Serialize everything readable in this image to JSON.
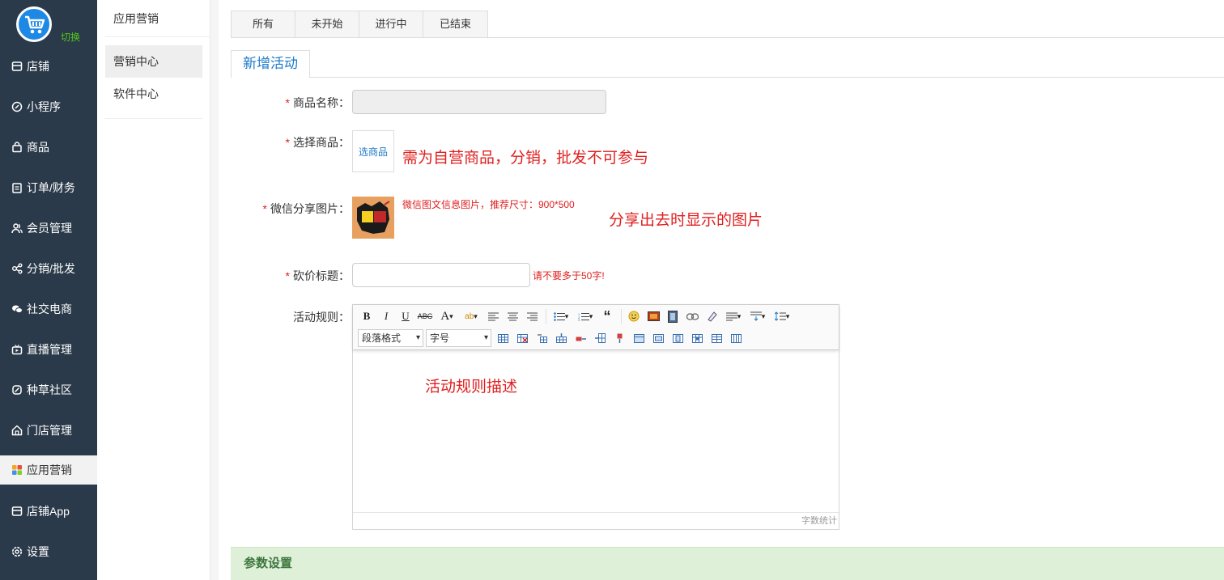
{
  "nav": {
    "switch_label": "切换",
    "items": [
      {
        "label": "店铺",
        "icon": "store-icon"
      },
      {
        "label": "小程序",
        "icon": "miniprogram-icon"
      },
      {
        "label": "商品",
        "icon": "bag-icon"
      },
      {
        "label": "订单/财务",
        "icon": "clipboard-icon"
      },
      {
        "label": "会员管理",
        "icon": "users-icon"
      },
      {
        "label": "分销/批发",
        "icon": "share-icon"
      },
      {
        "label": "社交电商",
        "icon": "chat-icon"
      },
      {
        "label": "直播管理",
        "icon": "video-icon"
      },
      {
        "label": "种草社区",
        "icon": "leaf-icon"
      },
      {
        "label": "门店管理",
        "icon": "home-icon"
      },
      {
        "label": "应用营销",
        "icon": "apps-icon"
      },
      {
        "label": "店铺App",
        "icon": "store-icon"
      },
      {
        "label": "设置",
        "icon": "gear-icon"
      }
    ],
    "active_index": 10
  },
  "subnav": {
    "title": "应用营销",
    "items": [
      {
        "label": "营销中心"
      },
      {
        "label": "软件中心"
      }
    ]
  },
  "tabs": [
    {
      "label": "所有"
    },
    {
      "label": "未开始"
    },
    {
      "label": "进行中"
    },
    {
      "label": "已结束"
    }
  ],
  "form": {
    "tab_label": "新增活动",
    "product_name_label": "商品名称：",
    "select_product_label": "选择商品：",
    "select_product_button": "选商品",
    "select_product_note": "需为自营商品，分销，批发不可参与",
    "share_image_label": "微信分享图片：",
    "share_image_hint": "微信图文信息图片，推荐尺寸：900*500",
    "share_image_note": "分享出去时显示的图片",
    "bargain_title_label": "砍价标题：",
    "bargain_title_hint": "请不要多于50字!",
    "rules_label": "活动规则：",
    "required_mark": "*"
  },
  "editor": {
    "paragraph_select": "段落格式",
    "font_size_select": "字号",
    "content": "活动规则描述",
    "word_count": "字数统计"
  },
  "params": {
    "title": "参数设置"
  },
  "colors": {
    "nav_bg": "#2b3a4a",
    "accent": "#1e7ac8",
    "required": "#e02020",
    "switch": "#52c41a",
    "params_bg": "#dff0d8"
  }
}
